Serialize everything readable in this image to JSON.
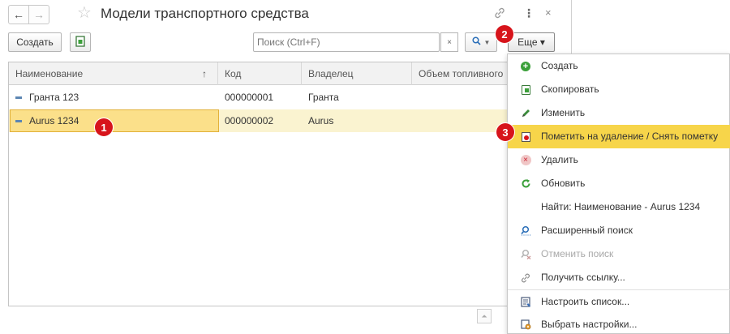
{
  "window": {
    "title": "Модели транспортного средства",
    "back_glyph": "←",
    "forward_glyph": "→",
    "star_glyph": "☆",
    "link_glyph": "🔗",
    "more_glyph": "⋮",
    "close_glyph": "×"
  },
  "toolbar": {
    "create_label": "Создать",
    "search_placeholder": "Поиск (Ctrl+F)",
    "search_clear_glyph": "×",
    "search_button_glyph": "🔍 ▾",
    "more_label": "Еще ▾"
  },
  "table": {
    "columns": [
      "Наименование",
      "Код",
      "Владелец",
      "Объем топливного"
    ],
    "sort_arrow": "↑",
    "rows": [
      {
        "name": "Гранта 123",
        "code": "000000001",
        "owner": "Гранта",
        "volume": ""
      },
      {
        "name": "Aurus 1234",
        "code": "000000002",
        "owner": "Aurus",
        "volume": ""
      }
    ]
  },
  "menu": {
    "items": [
      {
        "label": "Создать",
        "icon": "plus-circle-icon"
      },
      {
        "label": "Скопировать",
        "icon": "copy-icon"
      },
      {
        "label": "Изменить",
        "icon": "pencil-icon"
      },
      {
        "label": "Пометить на удаление / Снять пометку",
        "icon": "delete-mark-icon"
      },
      {
        "label": "Удалить",
        "icon": "delete-icon"
      },
      {
        "label": "Обновить",
        "icon": "refresh-icon"
      },
      {
        "label": "Найти: Наименование - Aurus 1234",
        "icon": ""
      },
      {
        "label": "Расширенный поиск",
        "icon": "advanced-search-icon"
      },
      {
        "label": "Отменить поиск",
        "icon": "cancel-search-icon"
      },
      {
        "label": "Получить ссылку...",
        "icon": "link-icon"
      },
      {
        "label": "Настроить список...",
        "icon": "list-settings-icon"
      },
      {
        "label": "Выбрать настройки...",
        "icon": "select-settings-icon"
      }
    ]
  },
  "badges": [
    "1",
    "2",
    "3"
  ],
  "scroll_glyph": "⏶",
  "colors": {
    "highlight": "#f7d54a",
    "selected_cell": "#fbe08a",
    "badge": "#d7141b",
    "accent_green": "#3ba03a"
  }
}
